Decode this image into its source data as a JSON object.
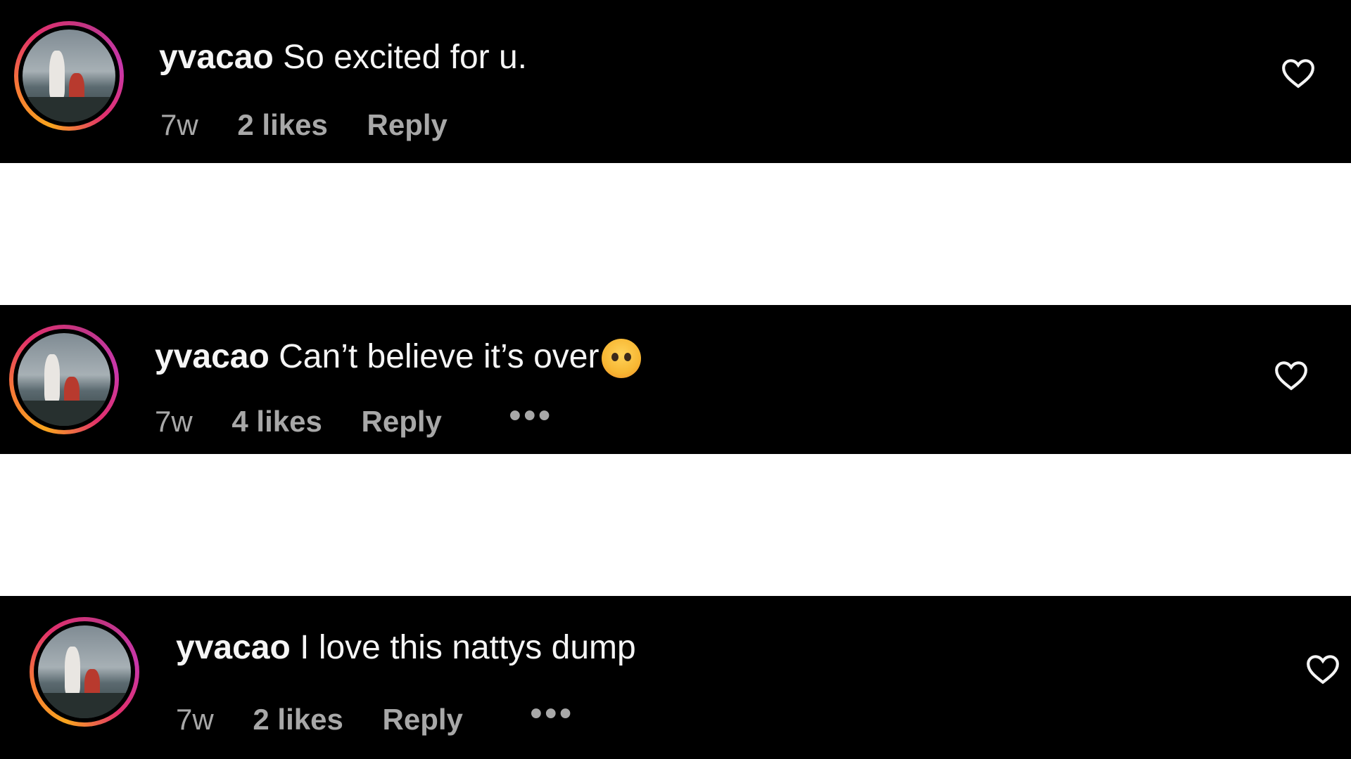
{
  "comments": [
    {
      "username": "yvacao",
      "text": "So excited for u.",
      "time": "7w",
      "likes": "2 likes",
      "reply": "Reply",
      "has_emoji": false,
      "has_more": false
    },
    {
      "username": "yvacao",
      "text": "Can’t believe it’s over",
      "emoji": "pleading-tears-emoji",
      "time": "7w",
      "likes": "4 likes",
      "reply": "Reply",
      "more": "•••",
      "has_emoji": true,
      "has_more": true
    },
    {
      "username": "yvacao",
      "text": "I love this nattys dump",
      "time": "7w",
      "likes": "2 likes",
      "reply": "Reply",
      "more": "•••",
      "has_emoji": false,
      "has_more": true
    }
  ],
  "icons": {
    "like": "heart-outline-icon",
    "more": "more-options-icon"
  },
  "colors": {
    "background": "#000000",
    "text": "#f5f5f5",
    "secondary_text": "#a8a8a8",
    "story_ring_start": "#f9a51e",
    "story_ring_end": "#c837ab"
  }
}
